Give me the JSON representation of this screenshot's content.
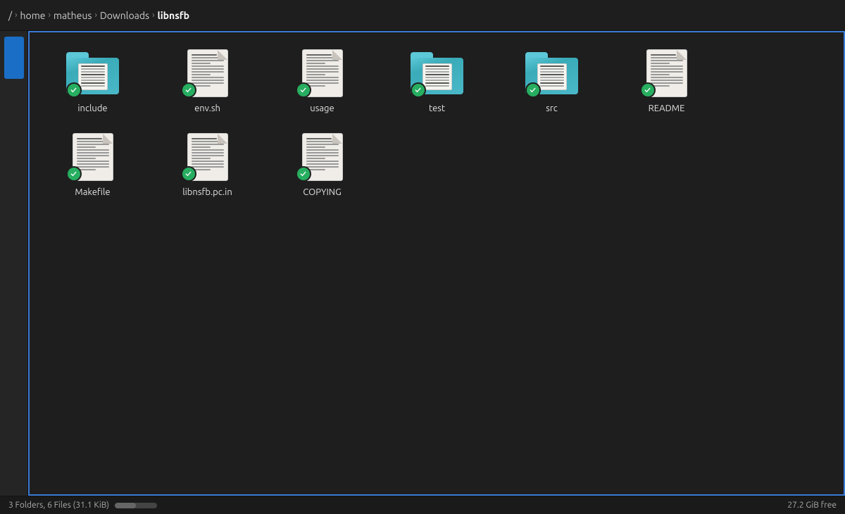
{
  "breadcrumb": {
    "root": "/",
    "home": "home",
    "user": "matheus",
    "downloads": "Downloads",
    "current": "libnsfb",
    "separators": [
      "›",
      "›",
      "›",
      "›"
    ]
  },
  "statusbar": {
    "info": "3 Folders, 6 Files (31.1 KiB)",
    "free": "27.2 GiB free"
  },
  "files": [
    {
      "id": 0,
      "name": "include",
      "type": "folder",
      "checked": true
    },
    {
      "id": 1,
      "name": "env.sh",
      "type": "file",
      "checked": true
    },
    {
      "id": 2,
      "name": "usage",
      "type": "file",
      "checked": true
    },
    {
      "id": 3,
      "name": "test",
      "type": "folder",
      "checked": true
    },
    {
      "id": 4,
      "name": "src",
      "type": "folder",
      "checked": true
    },
    {
      "id": 5,
      "name": "README",
      "type": "file",
      "checked": true
    },
    {
      "id": 6,
      "name": "Makefile",
      "type": "file",
      "checked": true
    },
    {
      "id": 7,
      "name": "libnsfb.pc.in",
      "type": "file",
      "checked": true
    },
    {
      "id": 8,
      "name": "COPYING",
      "type": "file",
      "checked": true
    }
  ],
  "colors": {
    "folder_teal": "#5cc8d8",
    "check_green": "#27ae60",
    "border_blue": "#3a7bd5",
    "accent_blue": "#1a6ec5"
  }
}
